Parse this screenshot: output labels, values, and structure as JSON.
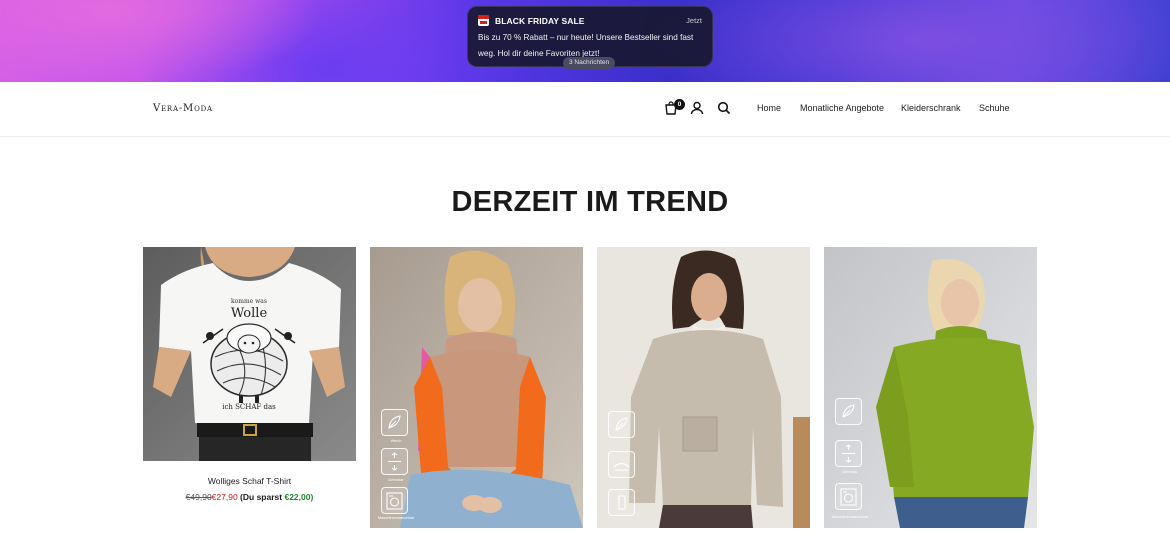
{
  "notification": {
    "title": "BLACK FRIDAY SALE",
    "time": "Jetzt",
    "body": "Bis zu 70 % Rabatt – nur heute! Unsere Bestseller sind fast weg. Hol dir deine Favoriten jetzt!",
    "count": "3 Nachrichten"
  },
  "header": {
    "logo": "Vera-Moda",
    "cart_count": "0",
    "nav": [
      "Home",
      "Monatliche Angebote",
      "Kleiderschrank",
      "Schuhe"
    ]
  },
  "section": {
    "title": "DERZEIT IM TREND"
  },
  "products": [
    {
      "name": "Wolliges Schaf T-Shirt",
      "price_old": "€49,90",
      "price_new": "€27,90",
      "save_label": "(Du sparst",
      "save_amount": "€22,00)",
      "print_top": "komme was",
      "print_main": "Wolle",
      "print_bottom": "ich SCHAF das"
    },
    {
      "features": [
        "Weich",
        "Dehnbar",
        "Maschinenwaschbar"
      ]
    },
    {
      "features": [
        "",
        "",
        ""
      ]
    },
    {
      "features": [
        "",
        "Dehnbar",
        "Maschinenwaschbar"
      ]
    }
  ],
  "colors": {
    "price_new": "#d11a1a",
    "save_amount": "#1d8a2c",
    "notification_bg": "#161628"
  }
}
